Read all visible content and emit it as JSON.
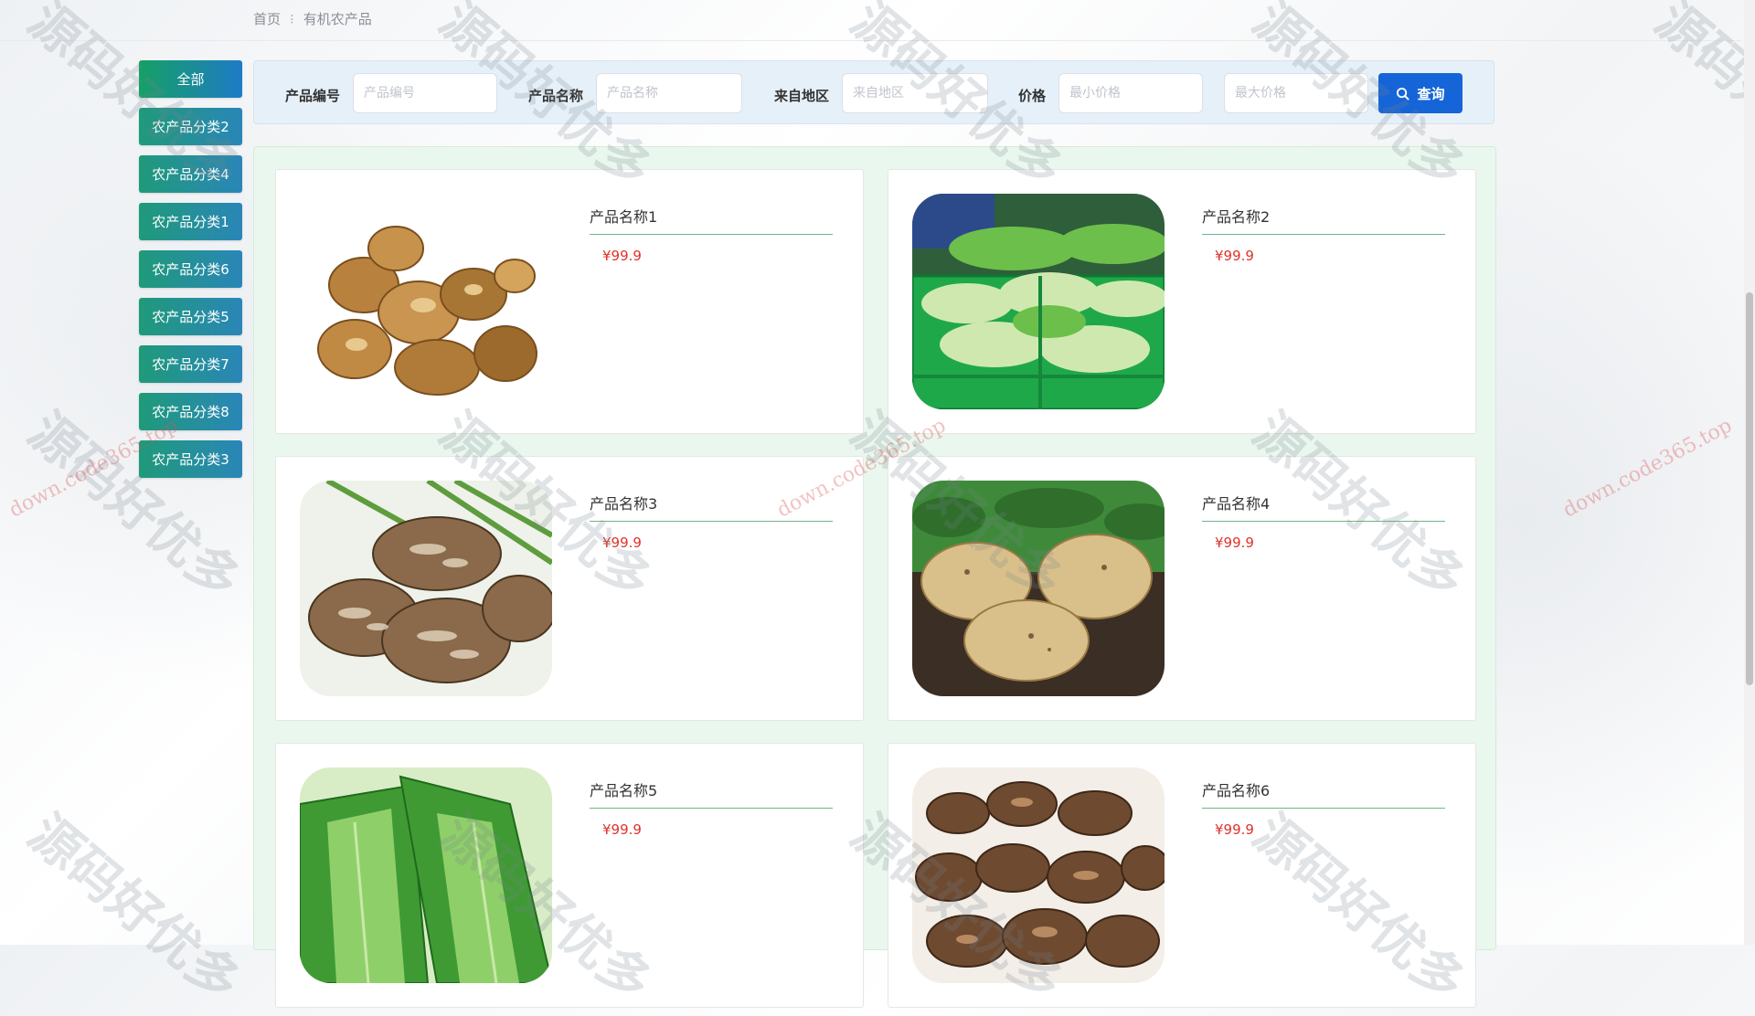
{
  "breadcrumb": {
    "home": "首页",
    "separator": "⁝",
    "current": "有机农产品"
  },
  "sidebar": {
    "items": [
      {
        "label": "全部"
      },
      {
        "label": "农产品分类2"
      },
      {
        "label": "农产品分类4"
      },
      {
        "label": "农产品分类1"
      },
      {
        "label": "农产品分类6"
      },
      {
        "label": "农产品分类5"
      },
      {
        "label": "农产品分类7"
      },
      {
        "label": "农产品分类8"
      },
      {
        "label": "农产品分类3"
      }
    ]
  },
  "search": {
    "code_label": "产品编号",
    "code_placeholder": "产品编号",
    "name_label": "产品名称",
    "name_placeholder": "产品名称",
    "region_label": "来自地区",
    "region_placeholder": "来自地区",
    "price_label": "价格",
    "min_placeholder": "最小价格",
    "max_placeholder": "最大价格",
    "button_label": "查询"
  },
  "products": [
    {
      "name": "产品名称1",
      "price": "¥99.9",
      "image": "dried-mushroom"
    },
    {
      "name": "产品名称2",
      "price": "¥99.9",
      "image": "cabbage-crate"
    },
    {
      "name": "产品名称3",
      "price": "¥99.9",
      "image": "shiitake"
    },
    {
      "name": "产品名称4",
      "price": "¥99.9",
      "image": "potato"
    },
    {
      "name": "产品名称5",
      "price": "¥99.9",
      "image": "leek"
    },
    {
      "name": "产品名称6",
      "price": "¥99.9",
      "image": "dried-mushroom-slices"
    }
  ],
  "watermarks": {
    "main": "源码好优多",
    "url": "down.code365.top"
  }
}
